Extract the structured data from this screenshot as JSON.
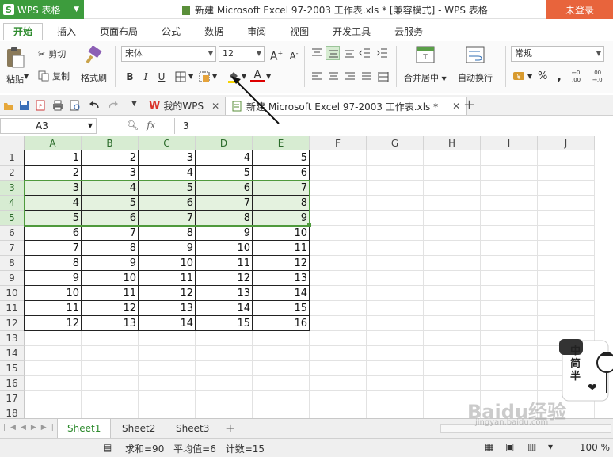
{
  "app": {
    "name": "WPS 表格",
    "login": "未登录"
  },
  "window": {
    "title": "新建 Microsoft Excel 97-2003 工作表.xls * [兼容模式] - WPS 表格"
  },
  "ribbon_tabs": [
    "开始",
    "插入",
    "页面布局",
    "公式",
    "数据",
    "审阅",
    "视图",
    "开发工具",
    "云服务"
  ],
  "ribbon": {
    "paste": "粘贴",
    "cut": "剪切",
    "copy": "复制",
    "format_painter": "格式刷",
    "font_name": "宋体",
    "font_size": "12",
    "merge_center": "合并居中",
    "wrap_text": "自动换行",
    "number_format": "常规",
    "percent": "%",
    "comma": ","
  },
  "doc_tabs": {
    "home": "我的WPS",
    "file": "新建 Microsoft Excel 97-2003 工作表.xls *"
  },
  "formula_bar": {
    "cell_ref": "A3",
    "fx": "fx",
    "value": "3"
  },
  "columns": [
    "A",
    "B",
    "C",
    "D",
    "E",
    "F",
    "G",
    "H",
    "I",
    "J"
  ],
  "rows": [
    "1",
    "2",
    "3",
    "4",
    "5",
    "6",
    "7",
    "8",
    "9",
    "10",
    "11",
    "12",
    "13",
    "14",
    "15",
    "16",
    "17",
    "18"
  ],
  "cells": [
    [
      "1",
      "2",
      "3",
      "4",
      "5"
    ],
    [
      "2",
      "3",
      "4",
      "5",
      "6"
    ],
    [
      "3",
      "4",
      "5",
      "6",
      "7"
    ],
    [
      "4",
      "5",
      "6",
      "7",
      "8"
    ],
    [
      "5",
      "6",
      "7",
      "8",
      "9"
    ],
    [
      "6",
      "7",
      "8",
      "9",
      "10"
    ],
    [
      "7",
      "8",
      "9",
      "10",
      "11"
    ],
    [
      "8",
      "9",
      "10",
      "11",
      "12"
    ],
    [
      "9",
      "10",
      "11",
      "12",
      "13"
    ],
    [
      "10",
      "11",
      "12",
      "13",
      "14"
    ],
    [
      "11",
      "12",
      "13",
      "14",
      "15"
    ],
    [
      "12",
      "13",
      "14",
      "15",
      "16"
    ]
  ],
  "sheets": [
    "Sheet1",
    "Sheet2",
    "Sheet3"
  ],
  "status": {
    "sum": "求和=90",
    "average": "平均值=6",
    "count": "计数=15",
    "zoom": "100 %"
  },
  "mascot_text": "中简半",
  "watermark": {
    "main": "Baidu经验",
    "sub": "jingyan.baidu.com"
  },
  "colors": {
    "accent": "#3d9c3d",
    "login": "#e8643c",
    "selection": "#4f9a3d",
    "highlight": "#e4f2df"
  }
}
